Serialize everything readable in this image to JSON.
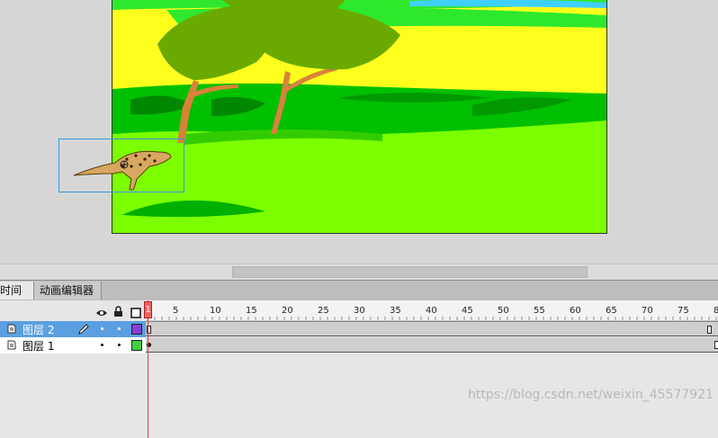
{
  "tabs": [
    {
      "label": "时间轴",
      "active": true
    },
    {
      "label": "动画编辑器",
      "active": false
    }
  ],
  "timeline": {
    "header_icons": [
      "eye-icon",
      "lock-icon",
      "outline-icon"
    ],
    "ruler_labels": [
      "1",
      "5",
      "10",
      "15",
      "20",
      "25",
      "30",
      "35",
      "40",
      "45",
      "50",
      "55",
      "60",
      "65",
      "70",
      "75",
      "8"
    ],
    "current_frame": 1,
    "layers": [
      {
        "name": "图层 2",
        "selected": true,
        "color": "#8b3fd0"
      },
      {
        "name": "图层 1",
        "selected": false,
        "color": "#40d040"
      }
    ]
  },
  "colors": {
    "selection": "#5aa0e0",
    "playhead": "#f26565"
  },
  "watermark": "https://blog.csdn.net/weixin_45577921"
}
